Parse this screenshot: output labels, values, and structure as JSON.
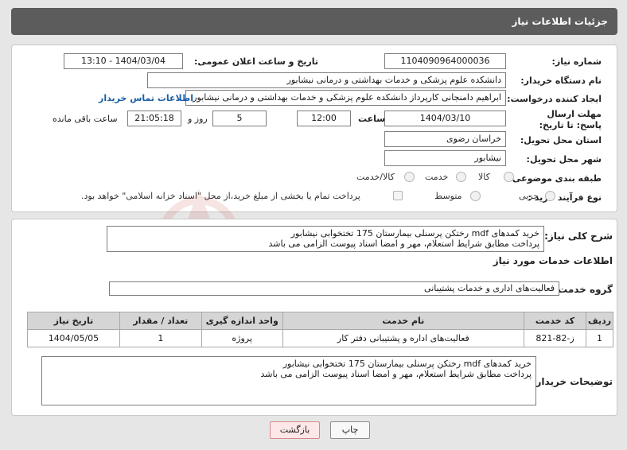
{
  "header": {
    "title": "جزئیات اطلاعات نیاز"
  },
  "form": {
    "need_number_label": "شماره نیاز:",
    "need_number": "1104090964000036",
    "announce_label": "تاریخ و ساعت اعلان عمومی:",
    "announce_value": "1404/03/04 - 13:10",
    "buyer_org_label": "نام دستگاه خریدار:",
    "buyer_org": "دانشکده علوم پزشکی و خدمات بهداشتی و درمانی نیشابور",
    "creator_label": "ایجاد کننده درخواست:",
    "creator": "ابراهیم دامنجانی  کارپرداز دانشکده علوم پزشکی و خدمات بهداشتی و درمانی نیشابور",
    "contact_link": "اطلاعات تماس خریدار",
    "deadline_label": "مهلت ارسال پاسخ: تا تاریخ:",
    "deadline_date": "1404/03/10",
    "time_label": "ساعت",
    "deadline_time": "12:00",
    "days_count": "5",
    "days_label": "روز و",
    "remaining_time": "21:05:18",
    "remaining_label": "ساعت باقی مانده",
    "province_label": "استان محل تحویل:",
    "province": "خراسان رضوی",
    "city_label": "شهر محل تحویل:",
    "city": "نیشابور",
    "category_label": "طبقه بندی موضوعی:",
    "category_options": [
      "کالا",
      "خدمت",
      "کالا/خدمت"
    ],
    "process_label": "نوع فرآیند خرید :",
    "process_options": [
      "جزیی",
      "متوسط"
    ],
    "treasury_text": "پرداخت تمام یا بخشی از مبلغ خرید،از محل \"اسناد خزانه اسلامی\" خواهد بود."
  },
  "summary": {
    "label": "شرح کلی نیاز:",
    "line1": "خرید کمدهای mdf رختکن پرسنلی بیمارستان 175 تختخوابی نیشابور",
    "line2": "پرداخت مطابق شرایط استعلام، مهر و امضا اسناد پیوست الزامی می باشد"
  },
  "services": {
    "section_title": "اطلاعات خدمات مورد نیاز",
    "group_label": "گروه خدمت:",
    "group_value": "فعالیت‌های اداری و خدمات پشتیبانی",
    "table": {
      "headers": [
        "ردیف",
        "کد خدمت",
        "نام خدمت",
        "واحد اندازه گیری",
        "تعداد / مقدار",
        "تاریخ نیاز"
      ],
      "rows": [
        [
          "1",
          "ز-82-821",
          "فعالیت‌های اداره و پشتیبانی دفتر کار",
          "پروژه",
          "1",
          "1404/05/05"
        ]
      ]
    }
  },
  "buyer_notes": {
    "label": "توضیحات خریدار:",
    "line1": "خرید کمدهای mdf رختکن پرسنلی بیمارستان 175 تختخوابی نیشابور",
    "line2": "پرداخت مطابق شرایط استعلام، مهر و امضا اسناد پیوست الزامی می باشد"
  },
  "buttons": {
    "print": "چاپ",
    "back": "بازگشت"
  },
  "colors": {
    "header_bg": "#5c5c5c",
    "link": "#1a5fa8",
    "back_button": "#fde7e7"
  }
}
